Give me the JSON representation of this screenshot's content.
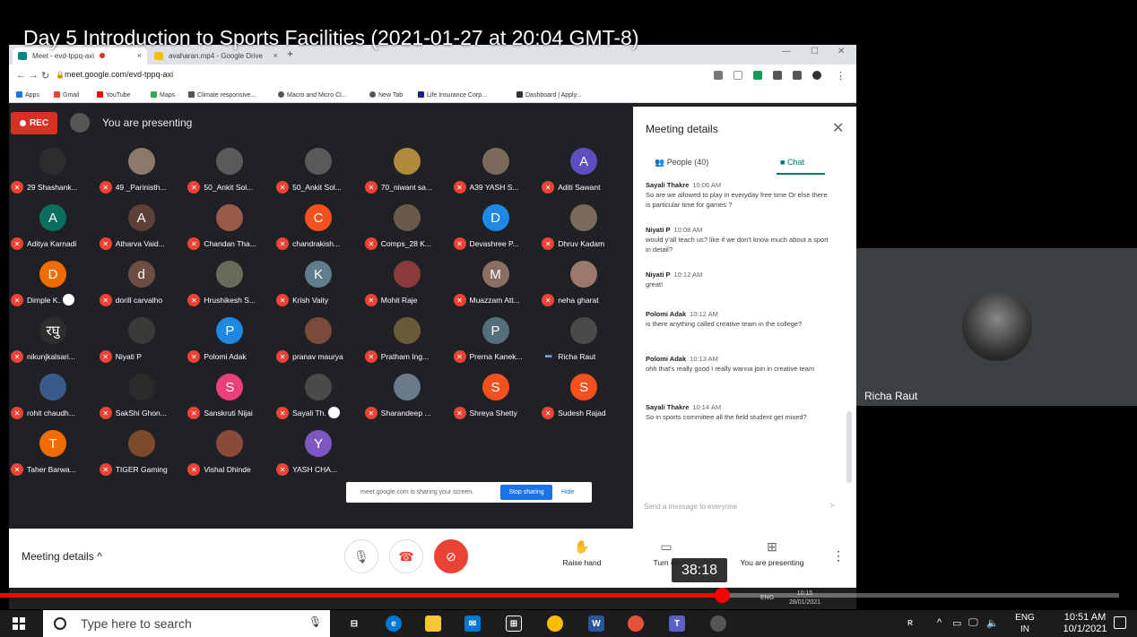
{
  "video": {
    "title": "Day 5 Introduction to Sports Facilities (2021-01-27 at 20:04 GMT-8)",
    "timestamp_tooltip": "38:18",
    "progress": 0.645
  },
  "browser": {
    "tabs": [
      {
        "label": "Meet - evd-tppq-axi",
        "active": true
      },
      {
        "label": "avaharan.mp4 - Google Drive",
        "active": false
      }
    ],
    "url": "meet.google.com/evd-tppq-axi",
    "bookmarks": [
      "Apps",
      "Gmail",
      "YouTube",
      "Maps",
      "Climate responsive...",
      "Macro and Micro Cl...",
      "New Tab",
      "Life Insurance Corp...",
      "Dashboard | Apply..."
    ]
  },
  "meet": {
    "rec_label": "REC",
    "presenting_label": "You are presenting",
    "participants": [
      {
        "name": "29 Shashank...",
        "initial": "",
        "color": "#2d2d2d"
      },
      {
        "name": "49 _Parinisth...",
        "initial": "",
        "color": "#8a7a6a"
      },
      {
        "name": "50_Ankit Sol...",
        "initial": "",
        "color": "#5a5a5a"
      },
      {
        "name": "50_Ankit Sol...",
        "initial": "",
        "color": "#5a5a5a"
      },
      {
        "name": "70_niwant sa...",
        "initial": "",
        "color": "#b08a3a"
      },
      {
        "name": "A39 YASH S...",
        "initial": "",
        "color": "#7a6a5a"
      },
      {
        "name": "Aditi Sawant",
        "initial": "A",
        "color": "#5c4fbf"
      },
      {
        "name": "Aditya Karnadi",
        "initial": "A",
        "color": "#0b6e5f"
      },
      {
        "name": "Atharva Vaid...",
        "initial": "A",
        "color": "#5d4037"
      },
      {
        "name": "Chandan Tha...",
        "initial": "",
        "color": "#9a5a4a"
      },
      {
        "name": "chandrakish...",
        "initial": "C",
        "color": "#f4511e"
      },
      {
        "name": "Comps_28 K...",
        "initial": "",
        "color": "#6a5a4a"
      },
      {
        "name": "Devashree P...",
        "initial": "D",
        "color": "#1e88e5"
      },
      {
        "name": "Dhruv Kadam",
        "initial": "",
        "color": "#7a6a5a"
      },
      {
        "name": "Dimple K...",
        "initial": "D",
        "color": "#ef6c00"
      },
      {
        "name": "dorill carvalho",
        "initial": "d",
        "color": "#6d4c41"
      },
      {
        "name": "Hrushikesh S...",
        "initial": "",
        "color": "#6a6a5a"
      },
      {
        "name": "Krish Vaity",
        "initial": "K",
        "color": "#607d8b"
      },
      {
        "name": "Mohit Raje",
        "initial": "",
        "color": "#8a3a3a"
      },
      {
        "name": "Muazzam Att...",
        "initial": "M",
        "color": "#8d6e63"
      },
      {
        "name": "neha gharat",
        "initial": "",
        "color": "#9a7a6a"
      },
      {
        "name": "nikunjkalsari...",
        "initial": "रघु",
        "color": "#2d2d2d"
      },
      {
        "name": "Niyati P",
        "initial": "",
        "color": "#3a3a3a"
      },
      {
        "name": "Polomi Adak",
        "initial": "P",
        "color": "#1e88e5"
      },
      {
        "name": "pranav maurya",
        "initial": "",
        "color": "#7a4a3a"
      },
      {
        "name": "Pratham Ing...",
        "initial": "",
        "color": "#6a5a3a"
      },
      {
        "name": "Prerna Kanek...",
        "initial": "P",
        "color": "#546e7a"
      },
      {
        "name": "Richa Raut",
        "initial": "",
        "color": "#4a4a4a"
      },
      {
        "name": "rohit chaudh...",
        "initial": "",
        "color": "#3a5a8a"
      },
      {
        "name": "SakShi Ghon...",
        "initial": "",
        "color": "#2a2a2a"
      },
      {
        "name": "Sanskruti Nijai",
        "initial": "S",
        "color": "#ec407a"
      },
      {
        "name": "Sayali Th...",
        "initial": "",
        "color": "#4a4a4a"
      },
      {
        "name": "Sharandeep ...",
        "initial": "",
        "color": "#6a7a8a"
      },
      {
        "name": "Shreya Shetty",
        "initial": "S",
        "color": "#f4511e"
      },
      {
        "name": "Sudesh Rajad",
        "initial": "S",
        "color": "#f4511e"
      },
      {
        "name": "Taher Barwa...",
        "initial": "T",
        "color": "#ef6c00"
      },
      {
        "name": "TIGER Gaming",
        "initial": "",
        "color": "#7a4a2a"
      },
      {
        "name": "Vishal Dhinde",
        "initial": "",
        "color": "#8a4a3a"
      },
      {
        "name": "YASH CHA...",
        "initial": "Y",
        "color": "#7e57c2"
      }
    ],
    "sharing_bar": {
      "text": "meet.google.com is sharing your screen.",
      "stop_label": "Stop sharing",
      "hide_label": "Hide"
    }
  },
  "panel": {
    "title": "Meeting details",
    "people_tab": "People (40)",
    "chat_tab": "Chat",
    "messages": [
      {
        "who": "Sayali Thakre",
        "time": "10:06 AM",
        "text": "So are we allowed to play in everyday free time Or else there is particular time for games ?"
      },
      {
        "who": "Niyati P",
        "time": "10:08 AM",
        "text": "would y'all teach us? like if we don't know much about a sport in detail?"
      },
      {
        "who": "Niyati P",
        "time": "10:12 AM",
        "text": "great!"
      },
      {
        "who": "Polomi Adak",
        "time": "10:12 AM",
        "text": "is there anything called creative team in the college?"
      },
      {
        "who": "Polomi Adak",
        "time": "10:13 AM",
        "text": "ohh that's really good I really wanna join in creative team"
      },
      {
        "who": "Sayali Thakre",
        "time": "10:14 AM",
        "text": "So in sports committee all the field student get mixed?"
      }
    ],
    "input_placeholder": "Send a message to everyone"
  },
  "meetbar": {
    "details_label": "Meeting details",
    "raise_hand": "Raise hand",
    "captions": "Turn on",
    "presenting": "You are presenting"
  },
  "inner_taskbar": {
    "lang": "ENG",
    "time": "10:15",
    "date": "28/01/2021"
  },
  "presenter_tile": {
    "name": "Richa Raut"
  },
  "taskbar": {
    "search_placeholder": "Type here to search",
    "lang_top": "ENG",
    "lang_bottom": "IN",
    "time": "10:51 AM",
    "date": "10/1/2021"
  }
}
